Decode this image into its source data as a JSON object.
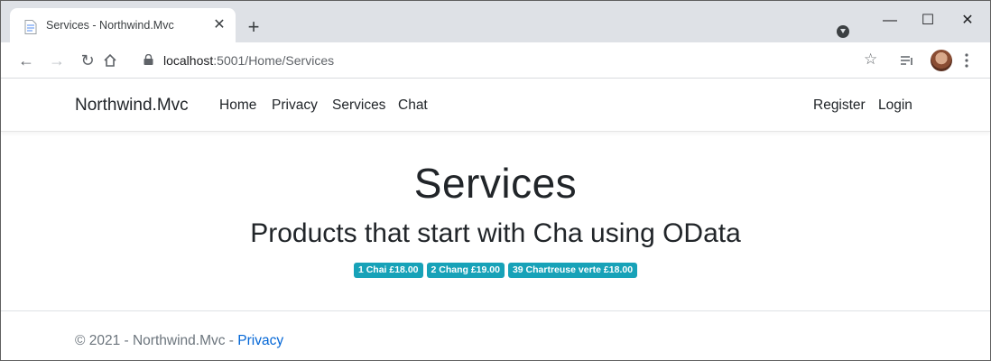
{
  "browser": {
    "tab_title": "Services - Northwind.Mvc",
    "tab_close": "✕",
    "new_tab": "+",
    "url_host": "localhost",
    "url_path": ":5001/Home/Services",
    "window_controls": {
      "minimize": "—",
      "maximize": "☐",
      "close": "✕"
    }
  },
  "navbar": {
    "brand": "Northwind.Mvc",
    "links": [
      "Home",
      "Privacy",
      "Services",
      "Chat"
    ],
    "right_links": [
      "Register",
      "Login"
    ]
  },
  "main": {
    "title": "Services",
    "subtitle": "Products that start with Cha using OData",
    "badges": [
      "1 Chai £18.00",
      "2 Chang £19.00",
      "39 Chartreuse verte £18.00"
    ]
  },
  "footer": {
    "text": "© 2021 - Northwind.Mvc - ",
    "link": "Privacy"
  },
  "colors": {
    "badge": "#17a2b8",
    "link": "#0366d6",
    "tabstrip": "#dee1e6"
  },
  "icons": [
    "page-icon",
    "back-icon",
    "forward-icon",
    "reload-icon",
    "home-icon",
    "lock-icon",
    "star-icon",
    "reading-list-icon",
    "menu-icon"
  ]
}
